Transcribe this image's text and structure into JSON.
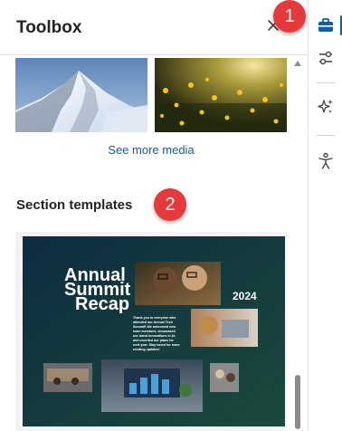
{
  "panel": {
    "title": "Toolbox",
    "close_icon": "close-icon"
  },
  "media": {
    "items": [
      {
        "name": "snowy-mountain-peak"
      },
      {
        "name": "yellow-flowers-sunlight"
      }
    ],
    "see_more_label": "See more media"
  },
  "templates": {
    "section_title": "Section templates",
    "card": {
      "headline_lines": [
        "Annual",
        "Summit",
        "Recap"
      ],
      "year": "2024",
      "body_lines": [
        "Thank you to everyone who",
        "attended our Annual Tech",
        "Summit! We welcomed new",
        "team members, showcased",
        "our latest innovations in AI,",
        "and unveiled our plans for",
        "next year. Stay tuned for more",
        "exciting updates!"
      ]
    }
  },
  "rail": {
    "icons": [
      "toolbox-icon",
      "sliders-icon",
      "sparkle-icon",
      "accessibility-icon"
    ],
    "selected": "toolbox-icon"
  },
  "callouts": [
    "1",
    "2"
  ],
  "colors": {
    "accent": "#115ea3",
    "callout": "#e63939",
    "template_bg": "#0f3a44"
  }
}
